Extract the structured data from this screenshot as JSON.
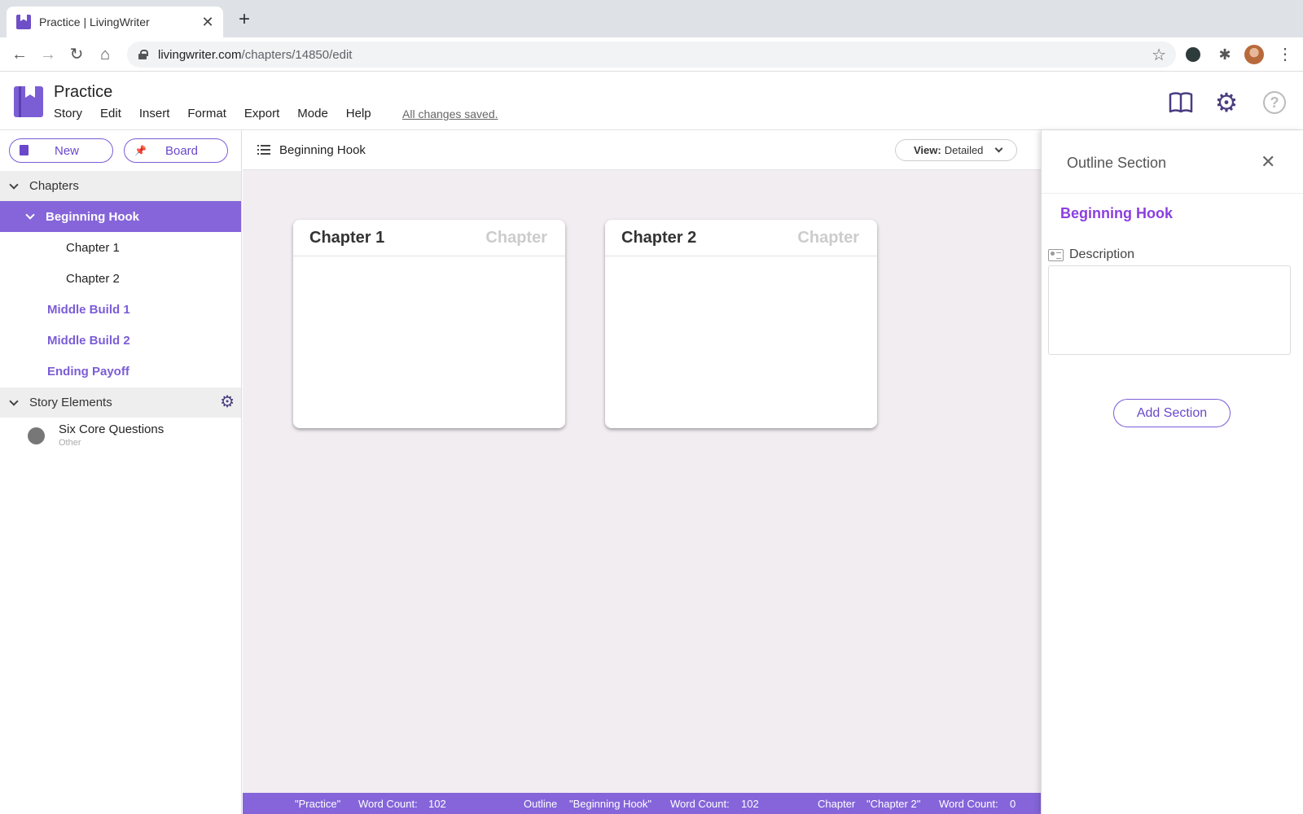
{
  "browser": {
    "tab_title": "Practice | LivingWriter",
    "url_host": "livingwriter.com",
    "url_path": "/chapters/14850/edit"
  },
  "app": {
    "title": "Practice",
    "menu": [
      "Story",
      "Edit",
      "Insert",
      "Format",
      "Export",
      "Mode",
      "Help"
    ],
    "save_status": "All changes saved."
  },
  "sidebar": {
    "new_label": "New",
    "board_label": "Board",
    "chapters_header": "Chapters",
    "sections": [
      {
        "label": "Beginning Hook",
        "children": [
          "Chapter 1",
          "Chapter 2"
        ]
      },
      {
        "label": "Middle Build 1"
      },
      {
        "label": "Middle Build 2"
      },
      {
        "label": "Ending Payoff"
      }
    ],
    "story_elements_header": "Story Elements",
    "elements": [
      {
        "name": "Six Core Questions",
        "type": "Other"
      }
    ]
  },
  "main": {
    "title": "Beginning Hook",
    "view_key": "View:",
    "view_value": "Detailed",
    "cards": [
      {
        "title": "Chapter 1",
        "type": "Chapter"
      },
      {
        "title": "Chapter 2",
        "type": "Chapter"
      }
    ]
  },
  "statusbar": {
    "story_name": "\"Practice\"",
    "word_count_label_1": "Word Count:",
    "story_count": "102",
    "outline_label": "Outline",
    "outline_name": "\"Beginning Hook\"",
    "word_count_label_2": "Word Count:",
    "outline_count": "102",
    "chapter_label": "Chapter",
    "chapter_name": "\"Chapter 2\"",
    "word_count_label_3": "Word Count:",
    "chapter_count": "0"
  },
  "panel": {
    "title": "Outline Section",
    "section_name": "Beginning Hook",
    "description_label": "Description",
    "description_value": "",
    "add_button": "Add Section"
  },
  "colors": {
    "accent": "#8565d9",
    "accent_text": "#6a48c9",
    "panel_heading": "#8a3fe0",
    "canvas_bg": "#f2edf1"
  }
}
